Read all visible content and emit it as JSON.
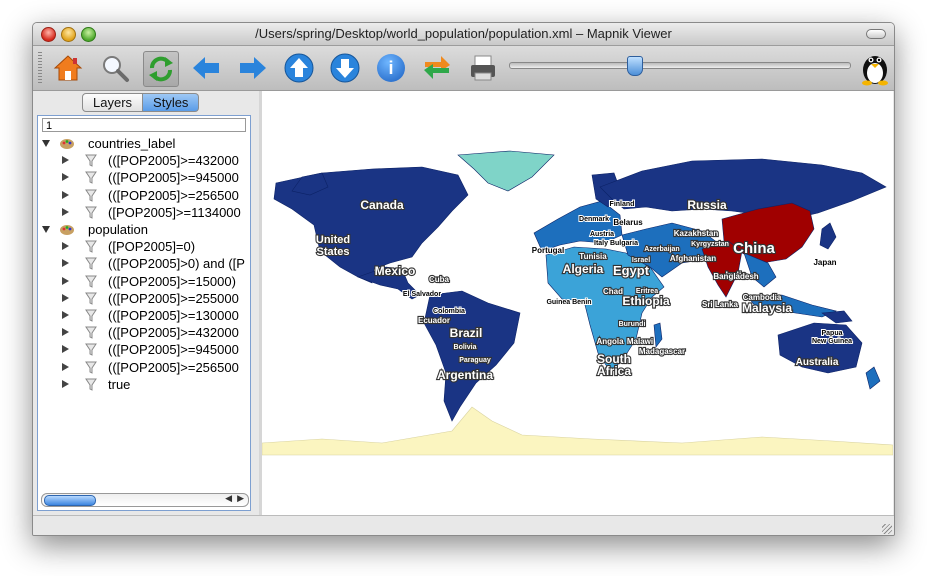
{
  "window": {
    "title": "/Users/spring/Desktop/world_population/population.xml – Mapnik Viewer"
  },
  "toolbar": {
    "buttons": [
      {
        "name": "home-button",
        "icon": "home-icon"
      },
      {
        "name": "zoom-button",
        "icon": "magnifier-icon"
      },
      {
        "name": "reload-button",
        "icon": "refresh-icon",
        "active": true
      },
      {
        "name": "pan-left-button",
        "icon": "arrow-left-icon"
      },
      {
        "name": "pan-right-button",
        "icon": "arrow-right-icon"
      },
      {
        "name": "pan-up-button",
        "icon": "arrow-up-icon"
      },
      {
        "name": "pan-down-button",
        "icon": "arrow-down-icon"
      },
      {
        "name": "info-button",
        "icon": "info-icon",
        "glyph": "i"
      },
      {
        "name": "swap-button",
        "icon": "swap-arrows-icon"
      },
      {
        "name": "print-button",
        "icon": "printer-icon"
      }
    ],
    "zoom_slider": {
      "value": 0.36
    },
    "tux_icon": "tux-penguin-icon"
  },
  "sidebar": {
    "tabs": {
      "layers": "Layers",
      "styles": "Styles",
      "selected": "Styles"
    },
    "filter_value": "1",
    "tree": [
      {
        "label": "countries_label",
        "level": 0,
        "expanded": true,
        "icon": "palette-icon"
      },
      {
        "label": "(([POP2005]>=432000",
        "level": 1,
        "icon": "filter-funnel-icon"
      },
      {
        "label": "(([POP2005]>=945000",
        "level": 1,
        "icon": "filter-funnel-icon"
      },
      {
        "label": "(([POP2005]>=256500",
        "level": 1,
        "icon": "filter-funnel-icon"
      },
      {
        "label": "([POP2005]>=1134000",
        "level": 1,
        "icon": "filter-funnel-icon"
      },
      {
        "label": "population",
        "level": 0,
        "expanded": true,
        "icon": "palette-icon"
      },
      {
        "label": "([POP2005]=0)",
        "level": 1,
        "icon": "filter-funnel-icon"
      },
      {
        "label": "(([POP2005]>0) and ([P",
        "level": 1,
        "icon": "filter-funnel-icon"
      },
      {
        "label": "(([POP2005]>=15000)",
        "level": 1,
        "icon": "filter-funnel-icon"
      },
      {
        "label": "(([POP2005]>=255000",
        "level": 1,
        "icon": "filter-funnel-icon"
      },
      {
        "label": "(([POP2005]>=130000",
        "level": 1,
        "icon": "filter-funnel-icon"
      },
      {
        "label": "(([POP2005]>=432000",
        "level": 1,
        "icon": "filter-funnel-icon"
      },
      {
        "label": "(([POP2005]>=945000",
        "level": 1,
        "icon": "filter-funnel-icon"
      },
      {
        "label": "(([POP2005]>=256500",
        "level": 1,
        "icon": "filter-funnel-icon"
      },
      {
        "label": "true",
        "level": 1,
        "icon": "filter-funnel-icon"
      }
    ]
  },
  "map": {
    "colors": {
      "ocean": "#ffffff",
      "dark": "#1a3484",
      "mid": "#1d6fbd",
      "light": "#3ba3d8",
      "pale": "#7fd4c8",
      "red": "#a00000",
      "ice": "#fbf5c0"
    },
    "labels": {
      "canada": "Canada",
      "russia": "Russia",
      "us1": "United",
      "us2": "States",
      "mexico": "Mexico",
      "brazil": "Brazil",
      "argentina": "Argentina",
      "china": "China",
      "india": "India",
      "australia": "Australia",
      "malaysia": "Malaysia",
      "ethiopia": "Ethiopia",
      "egypt": "Egypt",
      "algeria": "Algeria",
      "sa1": "South",
      "sa2": "Africa",
      "finland": "Finland",
      "denmark": "Denmark",
      "belarus": "Belarus",
      "austria": "Austria",
      "italy_bulgaria": "Italy Bulgaria",
      "portugal": "Portugal",
      "tunisia": "Tunisia",
      "israel": "Israel",
      "kazakhstan": "Kazakhstan",
      "azerbaijan": "Azerbaijan",
      "kyrgyzstan": "Kyrgyzstan",
      "afghanistan": "Afghanistan",
      "bangladesh": "Bangladesh",
      "japan": "Japan",
      "cuba": "Cuba",
      "el_salvador": "El Salvador",
      "colombia": "Colombia",
      "ecuador": "Ecuador",
      "bolivia": "Bolivia",
      "paraguay": "Paraguay",
      "guinea_benin": "Guinea Benin",
      "chad": "Chad",
      "eritrea": "Eritrea",
      "burundi": "Burundi",
      "angola": "Angola",
      "malawi": "Malawi",
      "madagascar": "Madagascar",
      "sri_lanka": "Sri Lanka",
      "cambodia": "Cambodia",
      "papua": "Papua",
      "new_guinea": "New Guinea"
    }
  }
}
